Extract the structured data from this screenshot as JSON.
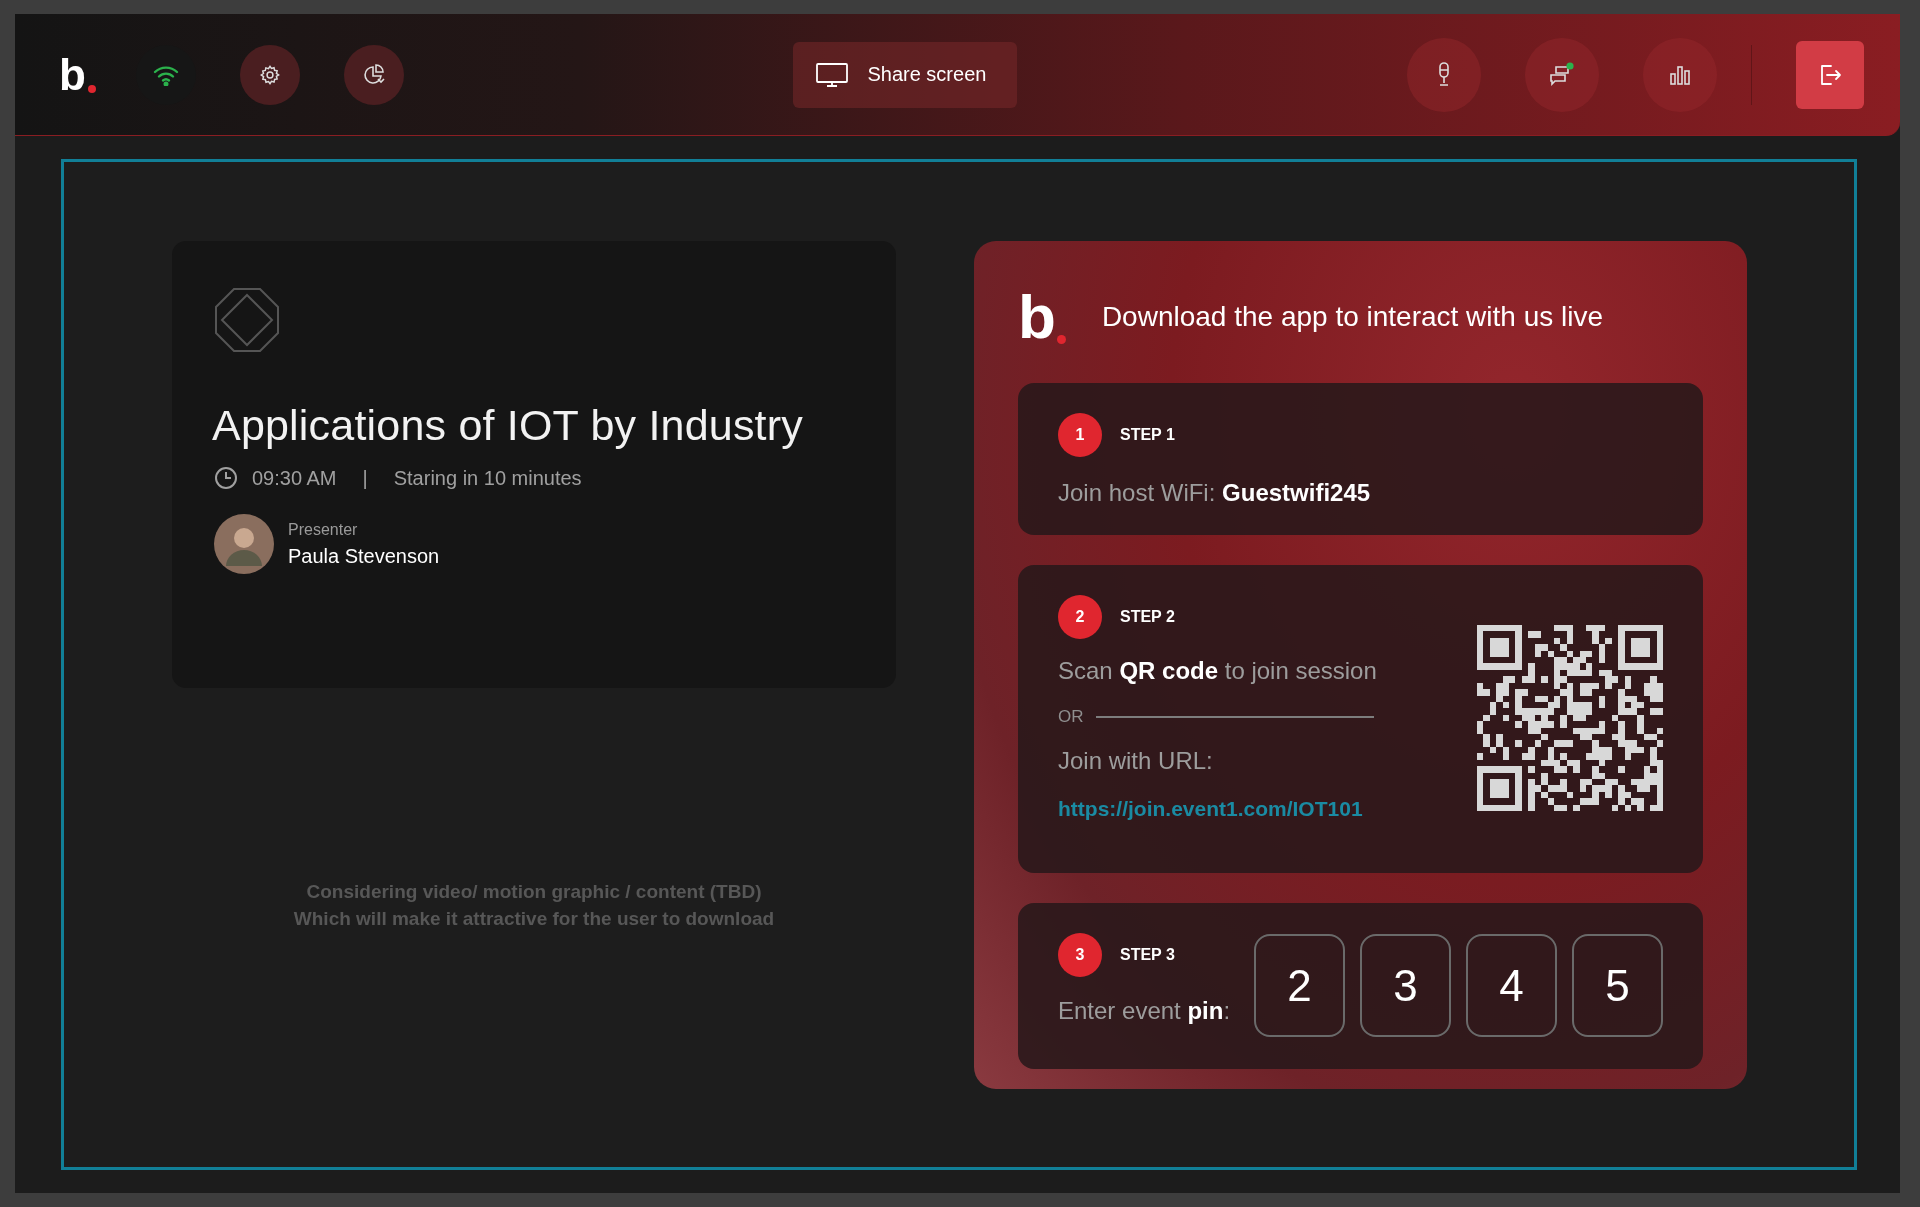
{
  "top_bar": {
    "logo": "b",
    "left_buttons": [
      {
        "kind": "wifi"
      },
      {
        "kind": "settings"
      },
      {
        "kind": "palette"
      }
    ],
    "share_button": {
      "label": "Share screen"
    },
    "right_buttons": [
      {
        "kind": "microphone"
      },
      {
        "kind": "chat"
      },
      {
        "kind": "chart"
      },
      {
        "kind": "exit"
      }
    ]
  },
  "session": {
    "title": "Applications of IOT by Industry",
    "time": "09:30 AM",
    "separator": "|",
    "status": "Staring in 10 minutes",
    "presenter_label": "Presenter",
    "presenter_name": "Paula Stevenson"
  },
  "note": [
    "Considering video/ motion graphic / content (TBD)",
    "Which will make it attractive for the user to download"
  ],
  "download": {
    "logo": "b",
    "heading": "Download the app to interact with us live",
    "steps": [
      {
        "kind": "wifi",
        "number": "1",
        "label": "STEP 1",
        "text": "Join host WiFi: **Guestwifi245**"
      },
      {
        "kind": "qr",
        "number": "2",
        "label": "STEP 2",
        "text": "Scan **QR code** to join session",
        "or": "OR",
        "url_label": "Join with URL:",
        "url": "https://join.event1.com/IOT101"
      },
      {
        "kind": "pin",
        "number": "3",
        "label": "STEP 3",
        "text": "Enter event **pin**:",
        "pin": [
          "2",
          "3",
          "4",
          "5"
        ]
      }
    ]
  }
}
